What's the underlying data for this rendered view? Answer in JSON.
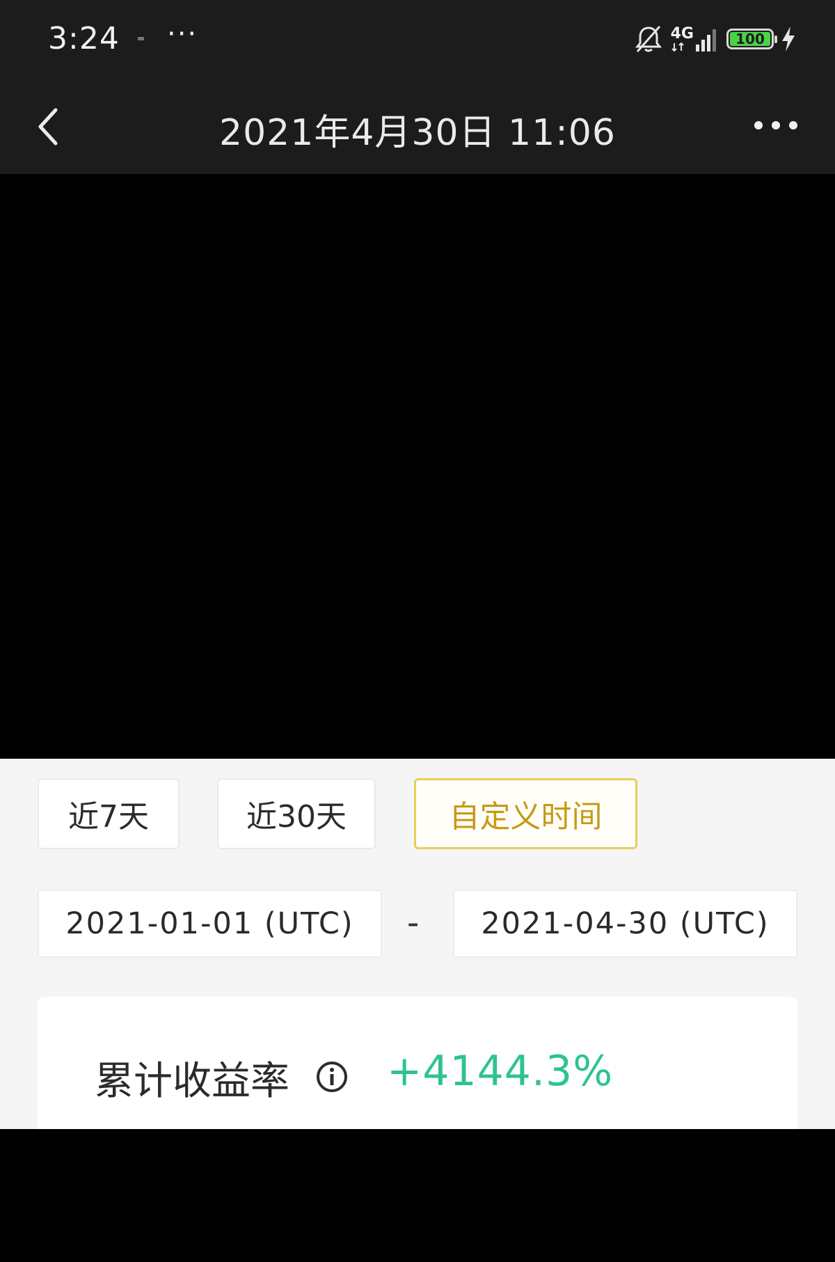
{
  "status_bar": {
    "time": "3:24",
    "overflow": "···",
    "network": "4G",
    "battery_level": "100",
    "icons": [
      "bell-muted-icon",
      "signal-icon",
      "battery-icon",
      "charging-bolt-icon"
    ]
  },
  "header": {
    "title": "2021年4月30日 11:06",
    "back_icon": "chevron-left-icon",
    "more_icon": "more-dots-icon"
  },
  "filters": {
    "tabs": [
      {
        "label": "近7天",
        "active": false
      },
      {
        "label": "近30天",
        "active": false
      },
      {
        "label": "自定义时间",
        "active": true
      }
    ],
    "start_date": "2021-01-01 (UTC)",
    "separator": "-",
    "end_date": "2021-04-30 (UTC)"
  },
  "result": {
    "label": "累计收益率",
    "value": "+4144.3%",
    "info_icon": "info-icon"
  },
  "colors": {
    "accent_gold": "#e8cf58",
    "gain_green": "#2ec38f",
    "header_bg": "#1c1c1c"
  }
}
